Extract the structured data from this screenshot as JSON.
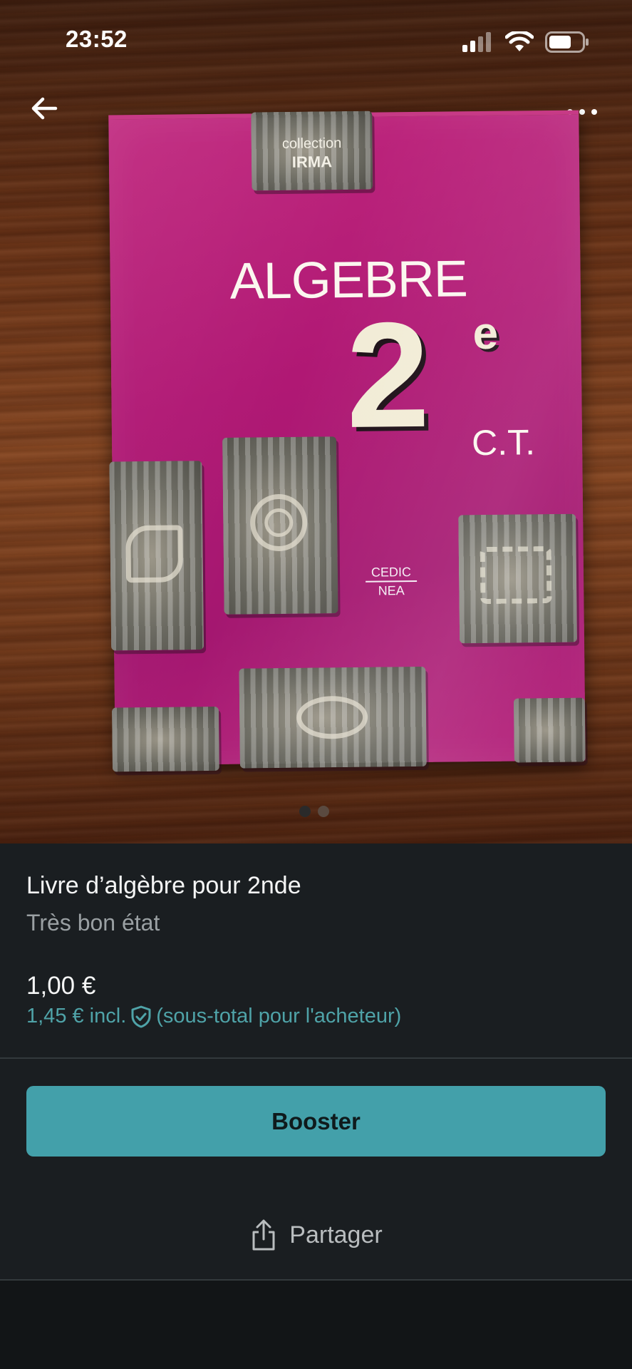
{
  "status_bar": {
    "time": "23:52"
  },
  "header": {
    "back_icon": "arrow-left-icon",
    "more_icon": "more-horizontal-icon"
  },
  "photo": {
    "book_cover": {
      "series_line1": "collection",
      "series_line2": "IRMA",
      "title": "ALGEBRE",
      "grade": "2",
      "grade_sup": "e",
      "grade_suffix": "C.T.",
      "publisher_line1": "CEDIC",
      "publisher_line2": "NEA"
    },
    "pagination": {
      "count": 2,
      "active_index": 0
    }
  },
  "item": {
    "title": "Livre d’algèbre pour 2nde",
    "condition": "Très bon état",
    "price": "1,00 €",
    "buyer_total_amount": "1,45 € incl.",
    "buyer_total_note": "(sous-total pour l'acheteur)",
    "buyer_protection_icon": "shield-check-icon"
  },
  "actions": {
    "boost_label": "Booster",
    "share_label": "Partager",
    "share_icon": "share-icon"
  },
  "colors": {
    "accent": "#43a0aa",
    "accent_text": "#4fa3a8",
    "background": "#1a1e21",
    "book_cover": "#b01874"
  }
}
